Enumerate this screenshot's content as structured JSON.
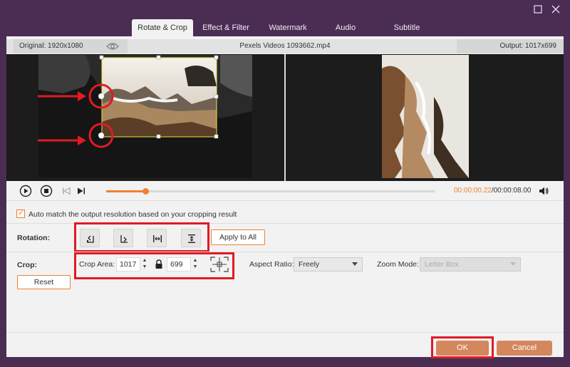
{
  "tabs": [
    {
      "label": "Rotate & Crop"
    },
    {
      "label": "Effect & Filter"
    },
    {
      "label": "Watermark"
    },
    {
      "label": "Audio"
    },
    {
      "label": "Subtitle"
    }
  ],
  "infobar": {
    "original": "Original: 1920x1080",
    "filename": "Pexels Videos 1093662.mp4",
    "output": "Output: 1017x699"
  },
  "player": {
    "current_time": "00:00:00.22",
    "separator": "/",
    "total_time": "00:00:08.00",
    "progress": 0.118
  },
  "auto_match": {
    "checked": true,
    "label": "Auto match the output resolution based on your cropping result"
  },
  "rotation": {
    "label": "Rotation:",
    "apply_all": "Apply to All"
  },
  "crop": {
    "label": "Crop:",
    "area_label": "Crop Area:",
    "width": "1017",
    "height": "699",
    "aspect_label": "Aspect Ratio:",
    "aspect_value": "Freely",
    "zoom_label": "Zoom Mode:",
    "zoom_value": "Letter Box",
    "reset": "Reset"
  },
  "footer": {
    "ok": "OK",
    "cancel": "Cancel"
  },
  "colors": {
    "accent": "#f0812f",
    "window_bg": "#4b2d54",
    "highlight": "#e11a24"
  }
}
